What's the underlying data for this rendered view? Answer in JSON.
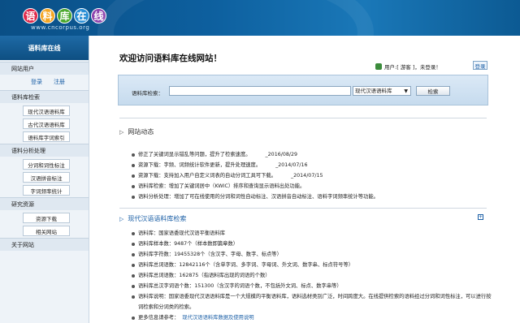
{
  "logo": {
    "chars": [
      "语",
      "料",
      "库",
      "在",
      "线"
    ],
    "colors": [
      "#e0284a",
      "#f5a623",
      "#4ba82e",
      "#2a8fd6",
      "#8e44ad"
    ],
    "url": "www.cncorpus.org"
  },
  "sidebar": {
    "header": "语料库在线",
    "sections": [
      {
        "label": "网站用户",
        "row": [
          "登录",
          "注册"
        ]
      },
      {
        "label": "语料库检索",
        "items": [
          "现代汉语语料库",
          "古代汉语语料库",
          "语料库字词索引"
        ]
      },
      {
        "label": "语料分析处理",
        "items": [
          "分词和词性标注",
          "汉语拼音标注",
          "字词频率统计"
        ]
      },
      {
        "label": "研究资源",
        "items": [
          "资源下载",
          "相关网站"
        ]
      },
      {
        "label": "关于网站"
      }
    ]
  },
  "main": {
    "title": "欢迎访问语料库在线网站！",
    "user_status": "用户:[ 游客 ]，未登录！",
    "login_button": "登录",
    "search": {
      "label": "语料库检索：",
      "value": "",
      "select": "现代汉语语料库",
      "button": "检索"
    },
    "news_title": "网站动态",
    "news": [
      {
        "text": "修正了关键词显示错乱等问题，提升了检索速度。",
        "date": "_2016/08/29"
      },
      {
        "text": "资源下载：字频、词频统计软件更新，提升处理速度。",
        "date": "_2014/07/16"
      },
      {
        "text": "资源下载：支持加入用户自定义词表的自动分词工具可下载。",
        "date": "_2014/07/15"
      },
      {
        "text": "语料库检索：增加了关键词居中（KWIC）排序和查询显示语料出处功能。",
        "date": ""
      },
      {
        "text": "语料分析处理：增加了可在线使用的分词和词性自动标注、汉语拼音自动标注、语料字词频率统计等功能。",
        "date": ""
      }
    ],
    "corpus_title": "现代汉语语料库检索",
    "corpus_info": [
      {
        "text": "语料库：国家语委现代汉语平衡语料库"
      },
      {
        "text": "语料库样本数：9487个（样本数即篇章数）"
      },
      {
        "text": "语料库字符数：19455328个（含汉字、字母、数字、标点等）"
      },
      {
        "text": "语料库总词语数：12842116个（含单字词、多字词、字母词、外文词、数字串、标点符号等）"
      },
      {
        "text": "语料库总词语数：162875（指语料库出现的词语的个数）"
      },
      {
        "text": "语料库总汉字词语个数：151300（含汉字的词语个数，不包括外文词、标点、数字串等）"
      },
      {
        "text": "语料库说明：国家语委现代汉语语料库是一个大规模的平衡语料库，语料选材类别广泛，时间跨度大。在线提供检索的语料经过分词和词性标注，可以进行按词检索和分词类的检索。"
      },
      {
        "text": "更多信息请参考：",
        "link": "现代汉语语料库数据及使用说明"
      }
    ]
  }
}
